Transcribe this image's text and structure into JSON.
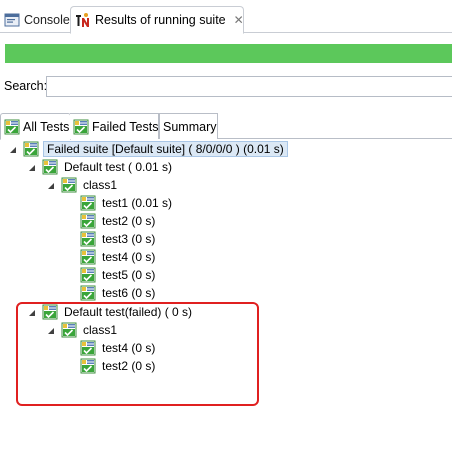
{
  "tabs": {
    "console": "Console",
    "results": "Results of running suite"
  },
  "progress": {
    "fraction": 1.0,
    "color": "#5cc85b"
  },
  "search": {
    "label": "Search:",
    "value": ""
  },
  "inner_tabs": {
    "all": "All Tests",
    "failed": "Failed Tests",
    "summary": "Summary"
  },
  "tree": {
    "root": "Failed suite [Default suite] ( 8/0/0/0 ) (0.01 s)",
    "test1": {
      "label": "Default test ( 0.01 s)",
      "class": "class1",
      "methods": [
        "test1  (0.01 s)",
        "test2  (0 s)",
        "test3  (0 s)",
        "test4  (0 s)",
        "test5  (0 s)",
        "test6  (0 s)"
      ]
    },
    "test2": {
      "label": "Default test(failed) ( 0 s)",
      "class": "class1",
      "methods": [
        "test4  (0 s)",
        "test2  (0 s)"
      ]
    }
  },
  "colors": {
    "highlight": "#e02020",
    "pass_green": "#3aa53a",
    "selection": "#dbe8f5"
  }
}
